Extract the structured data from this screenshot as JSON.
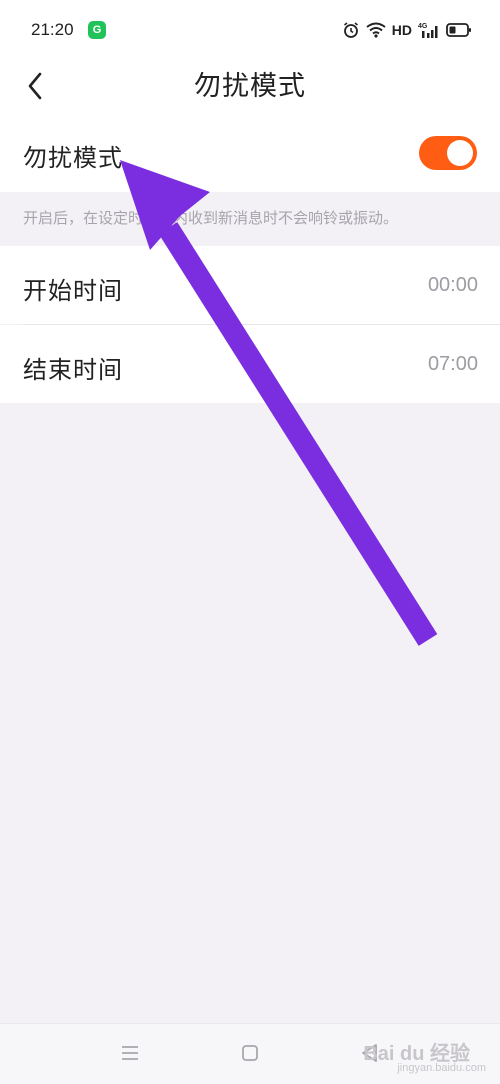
{
  "status_bar": {
    "time": "21:20",
    "app_badge": "G",
    "hd_label": "HD",
    "network_label": "4G",
    "icons": [
      "alarm-icon",
      "wifi-icon",
      "signal-icon",
      "battery-icon"
    ]
  },
  "header": {
    "title": "勿扰模式",
    "back_icon": "chevron-left-icon"
  },
  "dnd_setting": {
    "label": "勿扰模式",
    "enabled": true,
    "toggle_color": "#ff5c14"
  },
  "description": "开启后，在设定时间段内收到新消息时不会响铃或振动。",
  "schedule": {
    "start_label": "开始时间",
    "start_value": "00:00",
    "end_label": "结束时间",
    "end_value": "07:00"
  },
  "nav_bar": {
    "icons": [
      "menu-icon",
      "home-icon",
      "back-icon"
    ]
  },
  "watermark": {
    "logo": "Bai du 经验",
    "url": "jingyan.baidu.com"
  },
  "annotation": {
    "type": "arrow",
    "color": "#7b2ee0"
  }
}
